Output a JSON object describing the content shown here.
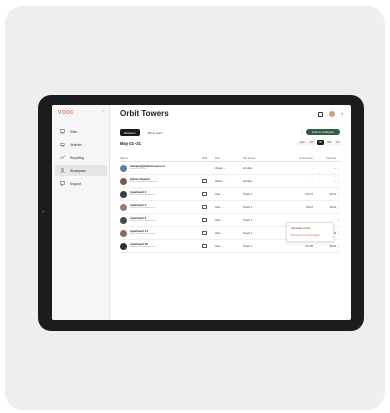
{
  "app": {
    "logo": "VOOC",
    "collapse_icon": "chevron-left-icon"
  },
  "sidebar": {
    "items": [
      {
        "label": "Sites",
        "icon": "grid-icon",
        "active": false
      },
      {
        "label": "Vehicles",
        "icon": "car-icon",
        "active": false
      },
      {
        "label": "Reporting",
        "icon": "chart-icon",
        "active": false
      },
      {
        "label": "Workspace",
        "icon": "user-icon",
        "active": true
      },
      {
        "label": "Support",
        "icon": "chat-icon",
        "active": false
      }
    ]
  },
  "header": {
    "title": "Orbit Towers"
  },
  "tabs": [
    {
      "label": "Members",
      "active": true
    },
    {
      "label": "Billing plans",
      "active": false
    }
  ],
  "actions": {
    "invite_label": "Invite to workspace",
    "more_icon": "kebab-icon"
  },
  "date_range": {
    "label": "May 01–31",
    "options": [
      {
        "label": "Last",
        "active": false
      },
      {
        "label": "1W",
        "active": false
      },
      {
        "label": "1M",
        "active": true
      },
      {
        "label": "6M",
        "active": false
      },
      {
        "label": "All",
        "active": false
      }
    ]
  },
  "table": {
    "columns": {
      "name": "Name ▾",
      "sms": "SMS",
      "role": "Role",
      "sites": "Site access",
      "consumption": "Consumption",
      "total": "Total cost"
    },
    "rows": [
      {
        "name": "domain@platformusers.co",
        "email": "admin@orbit.com",
        "role": "Viewer ⌄",
        "sites": "All sites",
        "consumption": "–",
        "total": "–",
        "sms": false,
        "avatar_color": "#5b7fa6"
      },
      {
        "name": "Esther Howard",
        "email": "esther.howard@example.com",
        "role": "Admin ⌄",
        "sites": "All sites",
        "consumption": "–",
        "total": "–",
        "sms": true,
        "avatar_color": "#7a5a48"
      },
      {
        "name": "Apartment 2",
        "email": "apartment2@example.com",
        "role": "User ⌄",
        "sites": "Tower 1",
        "consumption": "270.72",
        "total": "52.14",
        "sms": true,
        "avatar_color": "#3d3d3d"
      },
      {
        "name": "Apartment 5",
        "email": "apartment5@example.com",
        "role": "User ⌄",
        "sites": "Tower 1",
        "consumption": "89.16",
        "total": "48.61",
        "sms": true,
        "avatar_color": "#9b7b6b"
      },
      {
        "name": "Apartment 6",
        "email": "apartment6@example.com",
        "role": "User ⌄",
        "sites": "Tower 1",
        "consumption": "",
        "total": "",
        "sms": true,
        "avatar_color": "#4a4a4a"
      },
      {
        "name": "Apartment 14",
        "email": "apartment14@example.com",
        "role": "User ⌄",
        "sites": "Tower 3",
        "consumption": "270.72",
        "total": "70.84",
        "sms": true,
        "avatar_color": "#8a6a5a"
      },
      {
        "name": "Apartment 20",
        "email": "apartment20@example.com",
        "role": "User ⌄",
        "sites": "Tower 3",
        "consumption": "271.05",
        "total": "30.26",
        "sms": true,
        "avatar_color": "#2e2e2e"
      }
    ]
  },
  "context_menu": {
    "items": [
      {
        "label": "Generate invoice",
        "danger": false
      },
      {
        "label": "Remove from workspace",
        "danger": true
      }
    ]
  }
}
